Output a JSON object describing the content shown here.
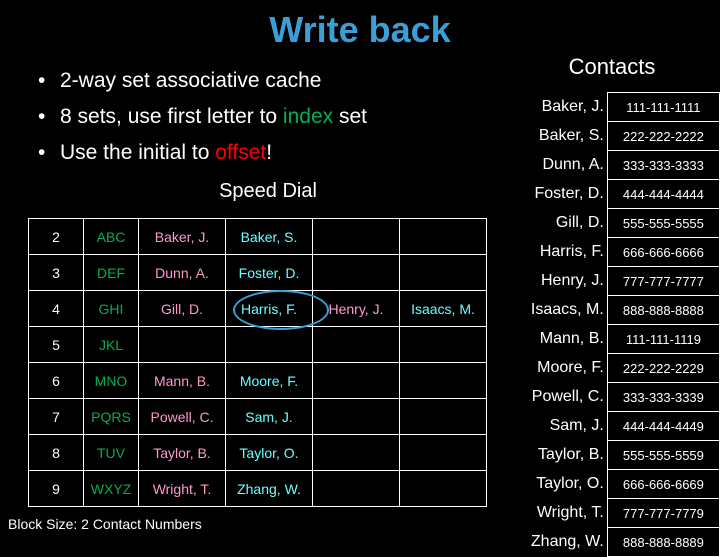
{
  "slide": {
    "title": "Write back",
    "bullets": [
      {
        "marker": "•",
        "segments": [
          {
            "text": "2-way set associative cache",
            "color": "white"
          }
        ]
      },
      {
        "marker": "•",
        "segments": [
          {
            "text": "8 sets, use first letter to ",
            "color": "white"
          },
          {
            "text": "index",
            "color": "green"
          },
          {
            "text": " set",
            "color": "white"
          }
        ]
      },
      {
        "marker": "•",
        "segments": [
          {
            "text": "Use the initial to ",
            "color": "white"
          },
          {
            "text": "offset",
            "color": "red"
          },
          {
            "text": "!",
            "color": "white"
          }
        ]
      }
    ],
    "speed_dial_caption": "Speed Dial",
    "block_size_note": "Block Size: 2 Contact Numbers",
    "contacts_heading": "Contacts",
    "highlight_color": "#3a9fd6",
    "title_color": "#3a9fd6"
  },
  "speed_dial_table": {
    "rows": [
      {
        "index": "2",
        "tag": "ABC",
        "cells": [
          {
            "text": "Baker, J.",
            "color": "pink"
          },
          {
            "text": "Baker, S.",
            "color": "cyan"
          },
          {
            "text": "",
            "color": "white"
          },
          {
            "text": "",
            "color": "white"
          }
        ]
      },
      {
        "index": "3",
        "tag": "DEF",
        "cells": [
          {
            "text": "Dunn, A.",
            "color": "pink"
          },
          {
            "text": "Foster, D.",
            "color": "cyan"
          },
          {
            "text": "",
            "color": "white"
          },
          {
            "text": "",
            "color": "white"
          }
        ]
      },
      {
        "index": "4",
        "tag": "GHI",
        "cells": [
          {
            "text": "Gill, D.",
            "color": "pink"
          },
          {
            "text": "Harris, F.",
            "color": "cyan"
          },
          {
            "text": "Henry, J.",
            "color": "pink"
          },
          {
            "text": "Isaacs, M.",
            "color": "cyan"
          }
        ]
      },
      {
        "index": "5",
        "tag": "JKL",
        "cells": [
          {
            "text": "",
            "color": "white"
          },
          {
            "text": "",
            "color": "white"
          },
          {
            "text": "",
            "color": "white"
          },
          {
            "text": "",
            "color": "white"
          }
        ]
      },
      {
        "index": "6",
        "tag": "MNO",
        "cells": [
          {
            "text": "Mann, B.",
            "color": "pink"
          },
          {
            "text": "Moore, F.",
            "color": "cyan"
          },
          {
            "text": "",
            "color": "white"
          },
          {
            "text": "",
            "color": "white"
          }
        ]
      },
      {
        "index": "7",
        "tag": "PQRS",
        "cells": [
          {
            "text": "Powell, C.",
            "color": "pink"
          },
          {
            "text": "Sam, J.",
            "color": "cyan"
          },
          {
            "text": "",
            "color": "white"
          },
          {
            "text": "",
            "color": "white"
          }
        ]
      },
      {
        "index": "8",
        "tag": "TUV",
        "cells": [
          {
            "text": "Taylor, B.",
            "color": "pink"
          },
          {
            "text": "Taylor, O.",
            "color": "cyan"
          },
          {
            "text": "",
            "color": "white"
          },
          {
            "text": "",
            "color": "white"
          }
        ]
      },
      {
        "index": "9",
        "tag": "WXYZ",
        "cells": [
          {
            "text": "Wright, T.",
            "color": "pink"
          },
          {
            "text": "Zhang, W.",
            "color": "cyan"
          },
          {
            "text": "",
            "color": "white"
          },
          {
            "text": "",
            "color": "white"
          }
        ]
      }
    ]
  },
  "contacts": {
    "entries": [
      {
        "name": "Baker, J.",
        "number": "111-111-1111"
      },
      {
        "name": "Baker, S.",
        "number": "222-222-2222"
      },
      {
        "name": "Dunn, A.",
        "number": "333-333-3333"
      },
      {
        "name": "Foster, D.",
        "number": "444-444-4444"
      },
      {
        "name": "Gill, D.",
        "number": "555-555-5555"
      },
      {
        "name": "Harris, F.",
        "number": "666-666-6666"
      },
      {
        "name": "Henry, J.",
        "number": "777-777-7777"
      },
      {
        "name": "Isaacs, M.",
        "number": "888-888-8888"
      },
      {
        "name": "Mann, B.",
        "number": "111-111-1119"
      },
      {
        "name": "Moore, F.",
        "number": "222-222-2229"
      },
      {
        "name": "Powell, C.",
        "number": "333-333-3339"
      },
      {
        "name": "Sam, J.",
        "number": "444-444-4449"
      },
      {
        "name": "Taylor, B.",
        "number": "555-555-5559"
      },
      {
        "name": "Taylor, O.",
        "number": "666-666-6669"
      },
      {
        "name": "Wright, T.",
        "number": "777-777-7779"
      },
      {
        "name": "Zhang, W.",
        "number": "888-888-8889"
      }
    ]
  }
}
